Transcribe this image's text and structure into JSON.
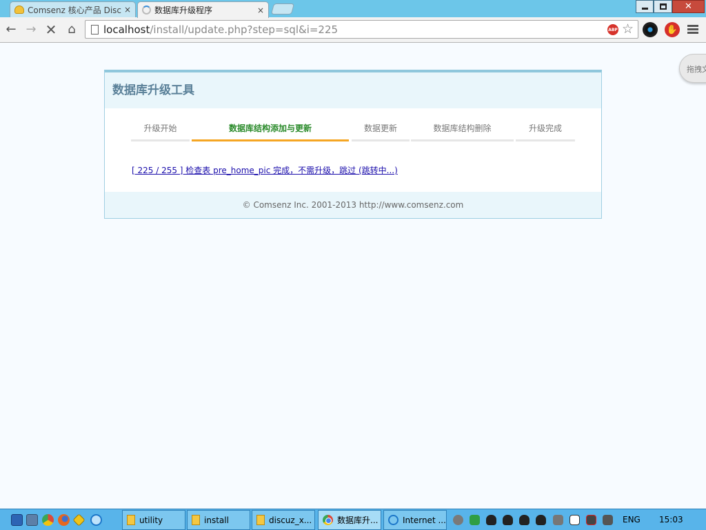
{
  "tabs": [
    {
      "title": "Comsenz 核心产品 Discuz",
      "close": "×"
    },
    {
      "title": "数据库升级程序",
      "close": "×"
    }
  ],
  "window_controls": {
    "close": "✕"
  },
  "address_bar": {
    "host": "localhost",
    "path": "/install/update.php?step=sql&i=225"
  },
  "extensions": {
    "adblock": "ABP",
    "stop": "✋"
  },
  "drag_bubble": {
    "text": "拖拽文"
  },
  "panel": {
    "title": "数据库升级工具",
    "steps": [
      {
        "label": "升级开始",
        "state": "normal"
      },
      {
        "label": "数据库结构添加与更新",
        "state": "current"
      },
      {
        "label": "数据更新",
        "state": "normal"
      },
      {
        "label": "数据库结构删除",
        "state": "normal"
      },
      {
        "label": "升级完成",
        "state": "normal"
      }
    ],
    "progress_message": "[ 225 / 255 ] 检查表 pre_home_pic 完成，不需升级，跳过 (跳转中...)",
    "progress": {
      "current": 225,
      "total": 255
    },
    "footer": "© Comsenz Inc. 2001-2013 http://www.comsenz.com"
  },
  "taskbar": {
    "items": [
      {
        "label": "utility",
        "icon": "folder-icon"
      },
      {
        "label": "install",
        "icon": "folder-icon"
      },
      {
        "label": "discuz_x...",
        "icon": "folder-icon"
      },
      {
        "label": "数据库升...",
        "icon": "chrome-icon",
        "active": true
      },
      {
        "label": "Internet ...",
        "icon": "ie-icon"
      }
    ],
    "language": "ENG",
    "clock": "15:03"
  },
  "colors": {
    "accent": "#f5a623",
    "current_step": "#2a8a2a",
    "taskbar": "#58b4ea",
    "titlebar": "#6cc6e9"
  }
}
